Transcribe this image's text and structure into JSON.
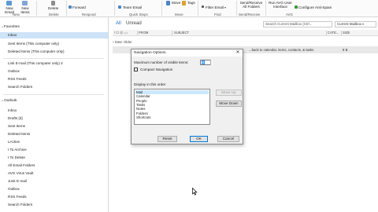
{
  "ribbon": {
    "new_email": "New Email",
    "new_items": "New Items",
    "delete": "Delete",
    "forward": "Forward",
    "team_email": "Team Email",
    "move": "Move",
    "tags": "Tags",
    "filter_email": "Filter Email",
    "send_receive_all": "Send/Receive All Folders",
    "run_avg": "Run AVG User Interface",
    "configure_antispam": "Configure Anti-Spam",
    "groups": [
      "New",
      "Delete",
      "Respond",
      "Quick Steps",
      "Move",
      "Find",
      "Send/Receive",
      "AVG"
    ]
  },
  "nav": {
    "favorites_header": "Favorites",
    "favorites": [
      {
        "label": "Inbox",
        "selected": true
      },
      {
        "label": "Sent Items (This computer only)",
        "selected": false
      },
      {
        "label": "Deleted Items (This computer only)",
        "selected": false
      }
    ],
    "group2": [
      {
        "label": "Link E-mail (This computer only) 4"
      },
      {
        "label": "Outbox"
      },
      {
        "label": "RSS Feeds"
      },
      {
        "label": "Search Folders"
      }
    ],
    "outlook_header": "Outlook",
    "outlook_items": [
      {
        "label": "Inbox"
      },
      {
        "label": "Drafts [3]"
      },
      {
        "label": "Sent Items"
      },
      {
        "label": "Deleted Items"
      },
      {
        "label": "LActive"
      },
      {
        "label": "I To Archive"
      },
      {
        "label": "I To Delete"
      },
      {
        "label": "All Email Folders"
      },
      {
        "label": "AVG Virus Vault"
      },
      {
        "label": "Junk E-mail"
      },
      {
        "label": "Outbox"
      },
      {
        "label": "RSS Feeds"
      },
      {
        "label": "Search Folders"
      }
    ]
  },
  "list": {
    "tab_all": "All",
    "tab_unread": "Unread",
    "search_placeholder": "Search Current Mailbox (Ctrl...",
    "scope": "Current Mailbox",
    "columns": {
      "icons": "! ☐ ⓪ 🖂",
      "from": "FROM",
      "subject": "SUBJECT",
      "categories": "CATE...",
      "size": "SIZE"
    },
    "group_label": "Date: Older",
    "message_subject": "...back to calendar, items, contacts, & tasks",
    "message_size": "8 B"
  },
  "dialog": {
    "title": "Navigation Options",
    "close": "✕",
    "max_label": "Maximum number of visible items:",
    "max_value": "8",
    "compact_label": "Compact Navigation",
    "order_label": "Display in this order",
    "order_items": [
      {
        "label": "Mail",
        "selected": true
      },
      {
        "label": "Calendar",
        "selected": false
      },
      {
        "label": "People",
        "selected": false
      },
      {
        "label": "Tasks",
        "selected": false
      },
      {
        "label": "Notes",
        "selected": false
      },
      {
        "label": "Folders",
        "selected": false
      },
      {
        "label": "Shortcuts",
        "selected": false
      }
    ],
    "move_up": "Move Up",
    "move_down": "Move Down",
    "reset": "Reset",
    "ok": "OK",
    "cancel": "Cancel"
  }
}
